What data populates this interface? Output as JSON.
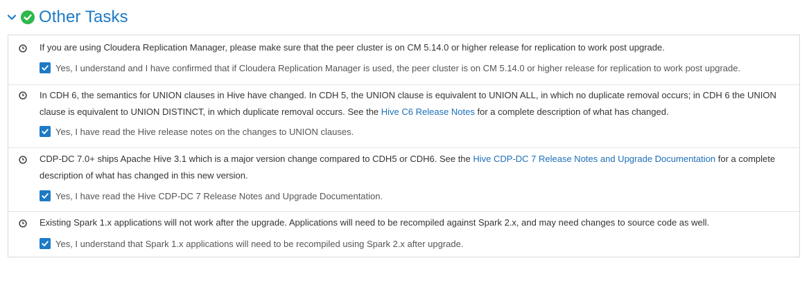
{
  "section": {
    "title": "Other Tasks",
    "collapse_icon": "chevron-down-icon",
    "status_icon": "check-circle-icon",
    "accent_color": "#1d7ac7",
    "success_color": "#2eb84b"
  },
  "tasks": [
    {
      "icon": "clock-icon",
      "text_parts": [
        "If you are using Cloudera Replication Manager, please make sure that the peer cluster is on CM 5.14.0 or higher release for replication to work post upgrade."
      ],
      "confirm_label": "Yes, I understand and I have confirmed that if Cloudera Replication Manager is used, the peer cluster is on CM 5.14.0 or higher release for replication to work post upgrade.",
      "checked": true
    },
    {
      "icon": "clock-icon",
      "text_parts": [
        "In CDH 6, the semantics for UNION clauses in Hive have changed. In CDH 5, the UNION clause is equivalent to UNION ALL, in which no duplicate removal occurs; in CDH 6 the UNION clause is equivalent to UNION DISTINCT, in which duplicate removal occurs. See the ",
        "Hive C6 Release Notes",
        " for a complete description of what has changed."
      ],
      "confirm_label": "Yes, I have read the Hive release notes on the changes to UNION clauses.",
      "checked": true
    },
    {
      "icon": "clock-icon",
      "text_parts": [
        "CDP-DC 7.0+ ships Apache Hive 3.1 which is a major version change compared to CDH5 or CDH6. See the ",
        "Hive CDP-DC 7 Release Notes and Upgrade Documentation",
        " for a complete description of what has changed in this new version."
      ],
      "confirm_label": "Yes, I have read the Hive CDP-DC 7 Release Notes and Upgrade Documentation.",
      "checked": true
    },
    {
      "icon": "clock-icon",
      "text_parts": [
        "Existing Spark 1.x applications will not work after the upgrade. Applications will need to be recompiled against Spark 2.x, and may need changes to source code as well."
      ],
      "confirm_label": "Yes, I understand that Spark 1.x applications will need to be recompiled using Spark 2.x after upgrade.",
      "checked": true
    }
  ]
}
